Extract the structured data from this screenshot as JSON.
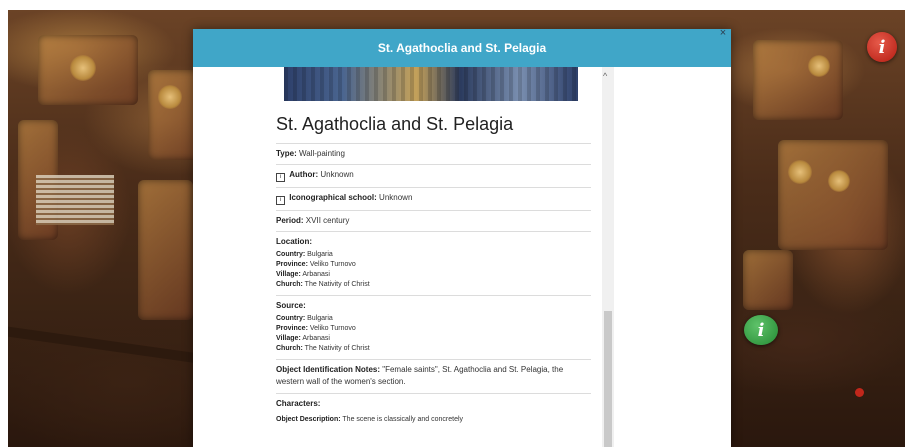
{
  "modal": {
    "header_title": "St. Agathoclia and St. Pelagia",
    "close_glyph": "×",
    "title": "St. Agathoclia and St. Pelagia",
    "fields": {
      "type_label": "Type:",
      "type_value": "Wall-painting",
      "author_label": "Author:",
      "author_value": "Unknown",
      "school_label": "Iconographical school:",
      "school_value": "Unknown",
      "period_label": "Period:",
      "period_value": "XVII century"
    },
    "location": {
      "heading": "Location:",
      "country_label": "Country:",
      "country": "Bulgaria",
      "province_label": "Province:",
      "province": "Veliko Turnovo",
      "village_label": "Village:",
      "village": "Arbanasi",
      "church_label": "Church:",
      "church": "The Nativity of Christ"
    },
    "source": {
      "heading": "Source:",
      "country_label": "Country:",
      "country": "Bulgaria",
      "province_label": "Province:",
      "province": "Veliko Turnovo",
      "village_label": "Village:",
      "village": "Arbanasi",
      "church_label": "Church:",
      "church": "The Nativity of Christ"
    },
    "notes_label": "Object Identification Notes:",
    "notes_value": "\"Female saints\", St. Agathoclia and St. Pelagia, the western wall of the women's section.",
    "characters_label": "Characters:",
    "description_label": "Object Description:",
    "description_value": "The scene is classically and concretely"
  },
  "icons": {
    "info_glyph": "i",
    "mini_info_glyph": "i",
    "scroll_up_glyph": "^"
  },
  "colors": {
    "header_bg": "#40a6c8",
    "info_red": "#c1271b",
    "info_green": "#248a33"
  }
}
